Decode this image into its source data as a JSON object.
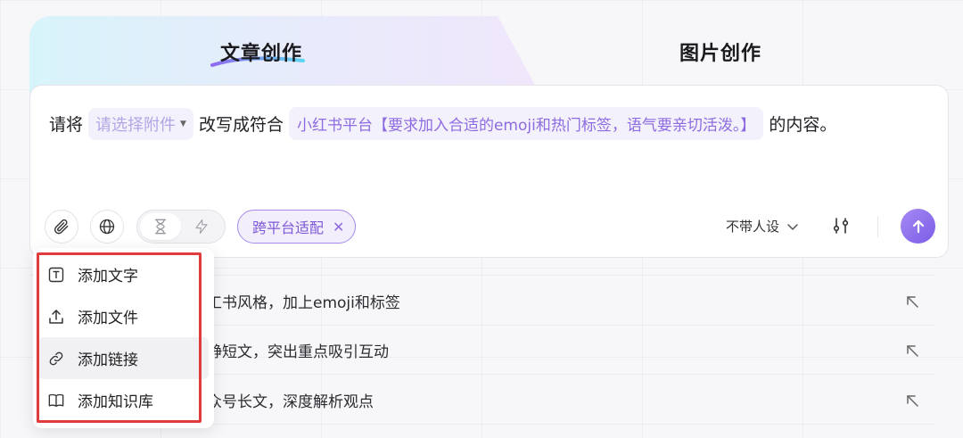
{
  "tabs": [
    {
      "label": "文章创作",
      "active": true
    },
    {
      "label": "图片创作",
      "active": false
    }
  ],
  "prompt": {
    "prefix": "请将",
    "attachment_placeholder": "请选择附件",
    "middle": "改写成符合",
    "platform_requirement": "小红书平台【要求加入合适的emoji和热门标签，语气要亲切活泼。】",
    "suffix": "的内容。"
  },
  "toolbar": {
    "attach_icon": "paperclip-icon",
    "web_icon": "globe-icon",
    "mode_toggle": [
      "hourglass-icon",
      "lightning-icon"
    ],
    "tag_label": "跨平台适配",
    "persona_label": "不带人设",
    "settings_icon": "sliders-icon",
    "send_icon": "arrow-up-icon"
  },
  "suggestions": [
    {
      "text": "工书风格，加上emoji和标签"
    },
    {
      "text": "静短文，突出重点吸引互动"
    },
    {
      "text": "众号长文，深度解析观点"
    }
  ],
  "menu": {
    "items": [
      {
        "label": "添加文字",
        "icon": "text-box-icon"
      },
      {
        "label": "添加文件",
        "icon": "upload-icon"
      },
      {
        "label": "添加链接",
        "icon": "link-icon"
      },
      {
        "label": "添加知识库",
        "icon": "book-icon"
      }
    ]
  },
  "colors": {
    "accent": "#8d6be0",
    "highlight_box": "#e03c3c"
  }
}
